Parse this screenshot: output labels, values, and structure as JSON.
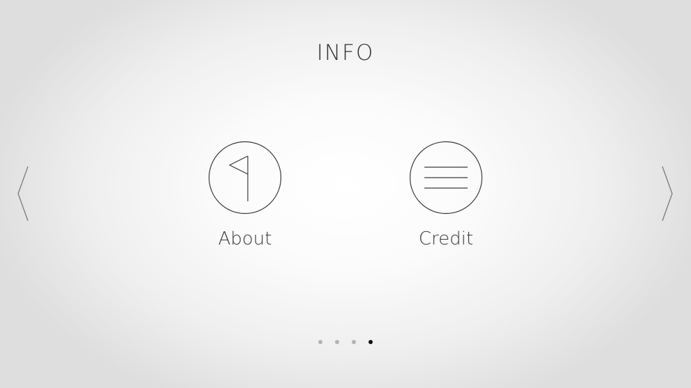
{
  "header": {
    "title": "INFO"
  },
  "navigation": {
    "prev_icon": "chevron-left-icon",
    "next_icon": "chevron-right-icon"
  },
  "menu": {
    "items": [
      {
        "label": "About",
        "icon": "flag-icon"
      },
      {
        "label": "Credit",
        "icon": "lines-icon"
      }
    ]
  },
  "pager": {
    "page_count": 4,
    "current_page": 4
  },
  "colors": {
    "line": "#3a3a3a",
    "dot_inactive": "#b3b3b3",
    "dot_active": "#111111"
  }
}
